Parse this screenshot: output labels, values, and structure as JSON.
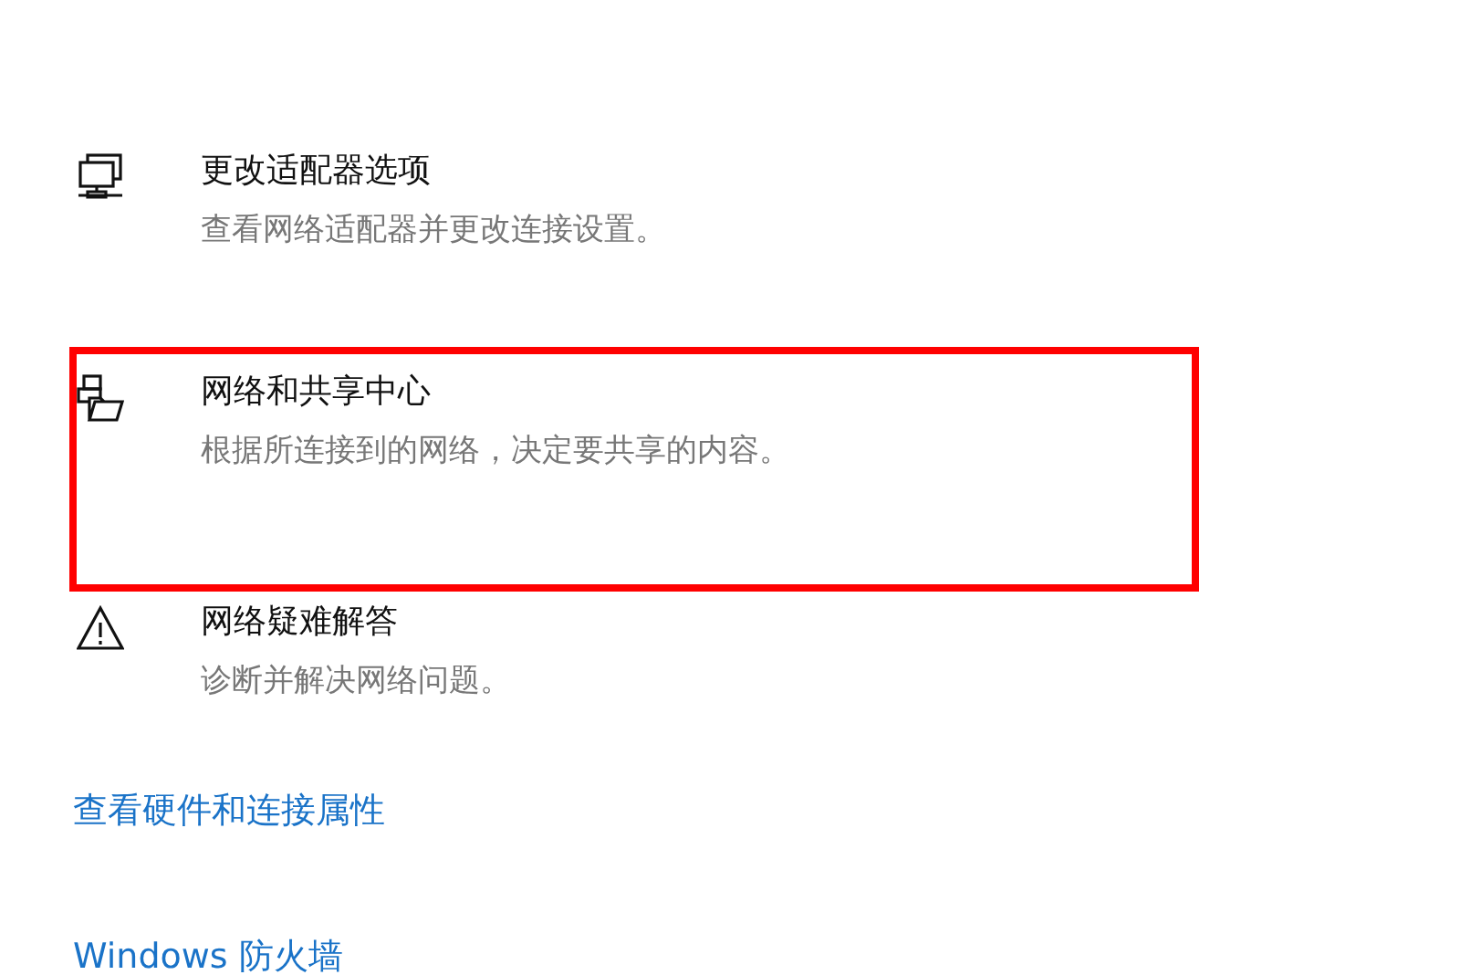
{
  "items": [
    {
      "kind": "adapter",
      "title": "更改适配器选项",
      "subtitle": "查看网络适配器并更改连接设置。",
      "highlighted": false
    },
    {
      "kind": "sharing",
      "title": "网络和共享中心",
      "subtitle": "根据所连接到的网络，决定要共享的内容。",
      "highlighted": true
    },
    {
      "kind": "warning",
      "title": "网络疑难解答",
      "subtitle": "诊断并解决网络问题。",
      "highlighted": false
    }
  ],
  "links": [
    "查看硬件和连接属性",
    "Windows 防火墙"
  ]
}
